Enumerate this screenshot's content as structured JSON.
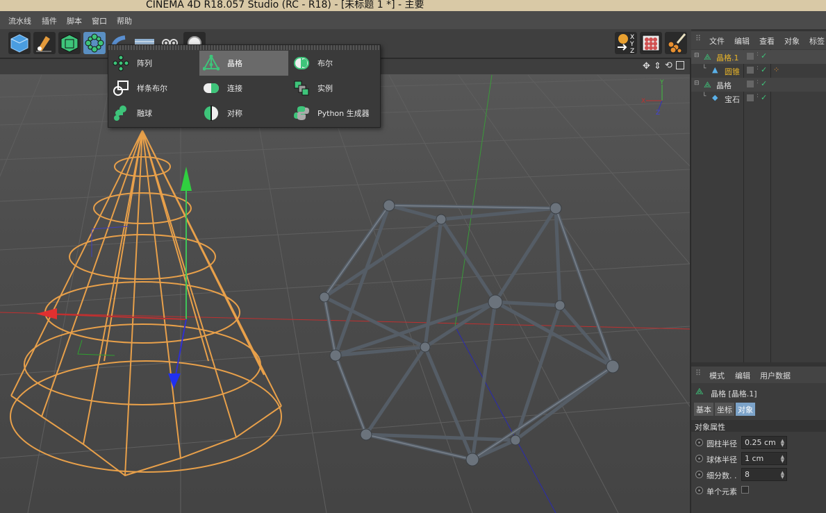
{
  "window": {
    "title": "CINEMA 4D R18.057 Studio (RC - R18) - [未标题 1 *] - 主要"
  },
  "menubar": {
    "items": [
      "流水线",
      "插件",
      "脚本",
      "窗口",
      "帮助"
    ]
  },
  "toolbar": {
    "left_icons": [
      "cube-icon",
      "pen-icon",
      "subdivision-icon",
      "array-icon",
      "bend-icon",
      "floor-icon",
      "camera-icon",
      "light-icon"
    ],
    "right_icons": [
      "coordinate-system-icon",
      "render-settings-icon",
      "paint-icon"
    ],
    "axis_labels": [
      "X",
      "Y",
      "Z"
    ]
  },
  "generator_menu": {
    "items": [
      {
        "label": "阵列",
        "icon": "array-icon"
      },
      {
        "label": "晶格",
        "icon": "atom-icon",
        "selected": true
      },
      {
        "label": "布尔",
        "icon": "boole-icon"
      },
      {
        "label": "样条布尔",
        "icon": "spline-boole-icon"
      },
      {
        "label": "连接",
        "icon": "connect-icon"
      },
      {
        "label": "实例",
        "icon": "instance-icon"
      },
      {
        "label": "融球",
        "icon": "metaball-icon"
      },
      {
        "label": "对称",
        "icon": "symmetry-icon"
      },
      {
        "label": "Python 生成器",
        "icon": "python-icon"
      }
    ]
  },
  "viewport": {
    "axis_indicator": {
      "y": "Y",
      "x": "X",
      "z": "Z"
    },
    "nav_icons": [
      "move-icon",
      "zoom-icon",
      "rotate-icon",
      "maximize-icon"
    ]
  },
  "object_manager": {
    "menu": [
      "文件",
      "编辑",
      "查看",
      "对象",
      "标签"
    ],
    "objects": [
      {
        "name": "晶格.1",
        "level": 0,
        "color": "#e8b429"
      },
      {
        "name": "圆锥",
        "level": 1,
        "color": "#e8b429"
      },
      {
        "name": "晶格",
        "level": 0,
        "color": "#dddddd"
      },
      {
        "name": "宝石",
        "level": 1,
        "color": "#dddddd"
      }
    ]
  },
  "attribute_manager": {
    "menu": [
      "模式",
      "编辑",
      "用户数据"
    ],
    "object_title": "晶格 [晶格.1]",
    "tabs": [
      {
        "label": "基本",
        "active": false
      },
      {
        "label": "坐标",
        "active": false
      },
      {
        "label": "对象",
        "active": true
      }
    ],
    "section": "对象属性",
    "properties": [
      {
        "label": "圆柱半径",
        "value": "0.25 cm"
      },
      {
        "label": "球体半径",
        "value": "1 cm"
      },
      {
        "label": "细分数. .",
        "value": "8"
      },
      {
        "label": "单个元素",
        "value": ""
      }
    ]
  },
  "colors": {
    "accent": "#7ca3c9",
    "selection_orange": "#e8a04a",
    "lattice_gray": "#505860",
    "green_icon": "#3ec47a"
  }
}
